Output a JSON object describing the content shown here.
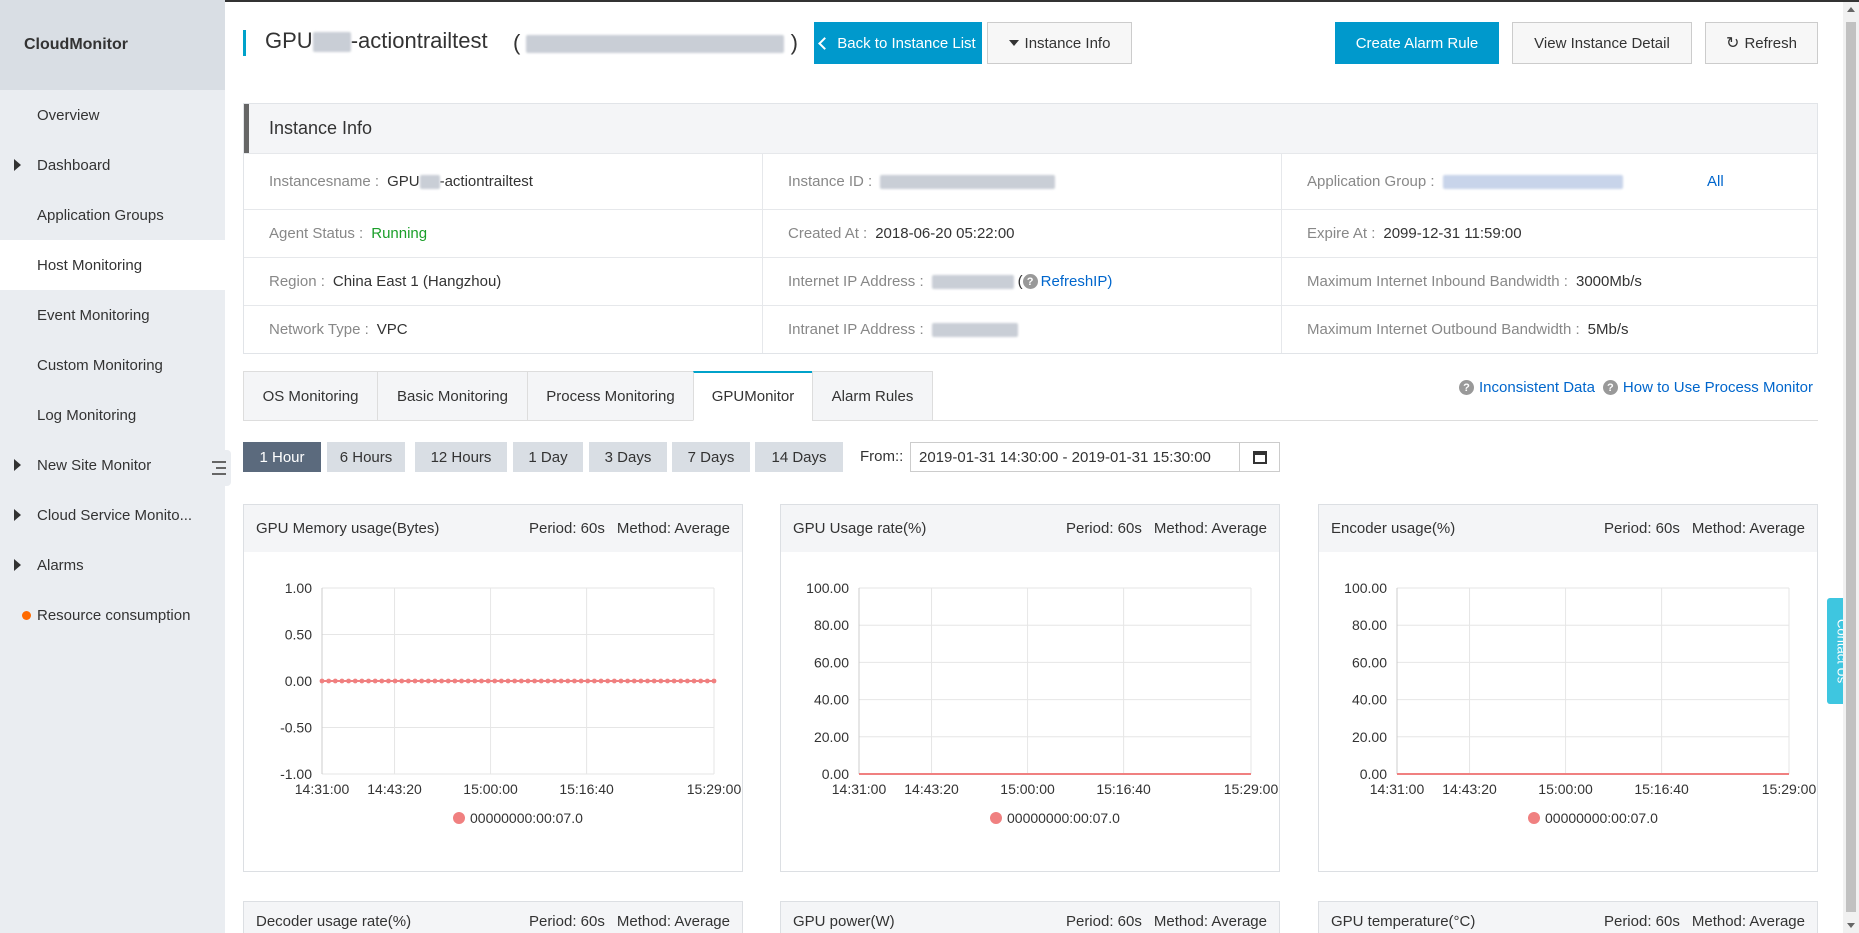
{
  "sidebar": {
    "title": "CloudMonitor",
    "items": [
      {
        "label": "Overview",
        "expandable": false
      },
      {
        "label": "Dashboard",
        "expandable": true
      },
      {
        "label": "Application Groups",
        "expandable": false
      },
      {
        "label": "Host Monitoring",
        "expandable": false,
        "active": true
      },
      {
        "label": "Event Monitoring",
        "expandable": false
      },
      {
        "label": "Custom Monitoring",
        "expandable": false
      },
      {
        "label": "Log Monitoring",
        "expandable": false
      },
      {
        "label": "New Site Monitor",
        "expandable": true
      },
      {
        "label": "Cloud Service Monito...",
        "expandable": true
      },
      {
        "label": "Alarms",
        "expandable": true
      },
      {
        "label": "Resource consumption",
        "dot": true
      }
    ]
  },
  "header": {
    "title_prefix": "GPU",
    "title_suffix": "-actiontrailtest",
    "ip_open": "(",
    "ip_close": ")",
    "back_button": "Back to Instance List",
    "instance_info_button": "Instance Info",
    "create_alarm_button": "Create Alarm Rule",
    "view_detail_button": "View Instance Detail",
    "refresh_button": "Refresh"
  },
  "instance_info": {
    "heading": "Instance Info",
    "instancesname_label": "Instancesname :",
    "instancesname_prefix": "GPU",
    "instancesname_suffix": "-actiontrailtest",
    "instance_id_label": "Instance ID :",
    "app_group_label": "Application Group :",
    "app_group_all": "All",
    "agent_status_label": "Agent Status :",
    "agent_status_value": "Running",
    "created_at_label": "Created At :",
    "created_at_value": "2018-06-20 05:22:00",
    "expire_at_label": "Expire At :",
    "expire_at_value": "2099-12-31 11:59:00",
    "region_label": "Region :",
    "region_value": "China East 1 (Hangzhou)",
    "internet_ip_label": "Internet IP Address :",
    "refresh_ip": "RefreshIP)",
    "refresh_ip_open": "(",
    "max_inbound_label": "Maximum Internet Inbound Bandwidth :",
    "max_inbound_value": "3000Mb/s",
    "network_type_label": "Network Type :",
    "network_type_value": "VPC",
    "intranet_ip_label": "Intranet IP Address :",
    "max_outbound_label": "Maximum Internet Outbound Bandwidth :",
    "max_outbound_value": "5Mb/s"
  },
  "tabs": [
    {
      "label": "OS Monitoring"
    },
    {
      "label": "Basic Monitoring"
    },
    {
      "label": "Process Monitoring"
    },
    {
      "label": "GPUMonitor",
      "active": true
    },
    {
      "label": "Alarm Rules"
    }
  ],
  "help_links": {
    "inconsistent": "Inconsistent Data",
    "how_to": "How to Use Process Monitor"
  },
  "time_range": {
    "buttons": [
      "1 Hour",
      "6 Hours",
      "12 Hours",
      "1 Day",
      "3 Days",
      "7 Days",
      "14 Days"
    ],
    "active_index": 0,
    "from_label": "From::",
    "range_value": "2019-01-31 14:30:00 - 2019-01-31 15:30:00"
  },
  "chart_meta": {
    "period": "Period: 60s",
    "method": "Method: Average"
  },
  "chart_data": [
    {
      "type": "line",
      "title": "GPU Memory usage(Bytes)",
      "x_ticks": [
        "14:31:00",
        "14:43:20",
        "15:00:00",
        "15:16:40",
        "15:29:00"
      ],
      "y_ticks": [
        "1.00",
        "0.50",
        "0.00",
        "-0.50",
        "-1.00"
      ],
      "ylim": [
        -1,
        1
      ],
      "series": [
        {
          "name": "00000000:00:07.0",
          "color": "#f08080",
          "value": 0,
          "markers": true
        }
      ]
    },
    {
      "type": "line",
      "title": "GPU Usage rate(%)",
      "x_ticks": [
        "14:31:00",
        "14:43:20",
        "15:00:00",
        "15:16:40",
        "15:29:00"
      ],
      "y_ticks": [
        "100.00",
        "80.00",
        "60.00",
        "40.00",
        "20.00",
        "0.00"
      ],
      "ylim": [
        0,
        100
      ],
      "series": [
        {
          "name": "00000000:00:07.0",
          "color": "#f08080",
          "value": 0,
          "markers": false
        }
      ]
    },
    {
      "type": "line",
      "title": "Encoder usage(%)",
      "x_ticks": [
        "14:31:00",
        "14:43:20",
        "15:00:00",
        "15:16:40",
        "15:29:00"
      ],
      "y_ticks": [
        "100.00",
        "80.00",
        "60.00",
        "40.00",
        "20.00",
        "0.00"
      ],
      "ylim": [
        0,
        100
      ],
      "series": [
        {
          "name": "00000000:00:07.0",
          "color": "#f08080",
          "value": 0,
          "markers": false
        }
      ]
    }
  ],
  "partial_charts": [
    {
      "title": "Decoder usage rate(%)"
    },
    {
      "title": "GPU power(W)"
    },
    {
      "title": "GPU temperature(°C)"
    }
  ],
  "contact_us": "Contact Us"
}
